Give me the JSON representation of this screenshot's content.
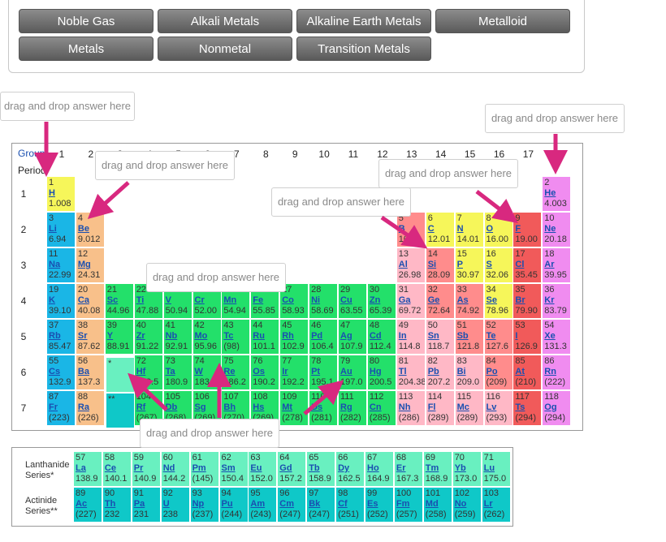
{
  "bank": {
    "buttons": [
      "Noble Gas",
      "Alkali Metals",
      "Alkaline Earth Metals",
      "Metalloid",
      "Metals",
      "Nonmetal",
      "Transition Metals"
    ]
  },
  "drop_placeholder": "drag and drop answer here",
  "headers": {
    "group": "Group",
    "period": "Period"
  },
  "groups": [
    "1",
    "2",
    "3",
    "4",
    "5",
    "6",
    "7",
    "8",
    "9",
    "10",
    "11",
    "12",
    "13",
    "14",
    "15",
    "16",
    "17",
    "18"
  ],
  "periods": [
    "1",
    "2",
    "3",
    "4",
    "5",
    "6",
    "7"
  ],
  "lanthanide_label": "Lanthanide Series*",
  "actinide_label": "Actinide Series**",
  "lanthanide_marker": "*",
  "actinide_marker": "**",
  "colors": {
    "alkali": "#1ab6e6",
    "alkaline": "#f8c08a",
    "transition": "#23e06a",
    "post_transition": "#ffb8c6",
    "metalloid": "#ff8c8c",
    "nonmetal": "#f6f65a",
    "halogen": "#f15a5a",
    "noble": "#f08cf0",
    "lanthanide": "#69f0c0",
    "actinide": "#0fc8c8",
    "hydrogen": "#f6f65a"
  },
  "elements": [
    {
      "n": "1",
      "s": "H",
      "w": "1.008",
      "c": "hydrogen",
      "g": 1,
      "p": 1
    },
    {
      "n": "2",
      "s": "He",
      "w": "4.003",
      "c": "noble",
      "g": 18,
      "p": 1
    },
    {
      "n": "3",
      "s": "Li",
      "w": "6.94",
      "c": "alkali",
      "g": 1,
      "p": 2
    },
    {
      "n": "4",
      "s": "Be",
      "w": "9.012",
      "c": "alkaline",
      "g": 2,
      "p": 2
    },
    {
      "n": "5",
      "s": "B",
      "w": "10.81",
      "c": "metalloid",
      "g": 13,
      "p": 2
    },
    {
      "n": "6",
      "s": "C",
      "w": "12.01",
      "c": "nonmetal",
      "g": 14,
      "p": 2
    },
    {
      "n": "7",
      "s": "N",
      "w": "14.01",
      "c": "nonmetal",
      "g": 15,
      "p": 2
    },
    {
      "n": "8",
      "s": "O",
      "w": "16.00",
      "c": "nonmetal",
      "g": 16,
      "p": 2
    },
    {
      "n": "9",
      "s": "F",
      "w": "19.00",
      "c": "halogen",
      "g": 17,
      "p": 2
    },
    {
      "n": "10",
      "s": "Ne",
      "w": "20.18",
      "c": "noble",
      "g": 18,
      "p": 2
    },
    {
      "n": "11",
      "s": "Na",
      "w": "22.99",
      "c": "alkali",
      "g": 1,
      "p": 3
    },
    {
      "n": "12",
      "s": "Mg",
      "w": "24.31",
      "c": "alkaline",
      "g": 2,
      "p": 3
    },
    {
      "n": "13",
      "s": "Al",
      "w": "26.98",
      "c": "post_transition",
      "g": 13,
      "p": 3
    },
    {
      "n": "14",
      "s": "Si",
      "w": "28.09",
      "c": "metalloid",
      "g": 14,
      "p": 3
    },
    {
      "n": "15",
      "s": "P",
      "w": "30.97",
      "c": "nonmetal",
      "g": 15,
      "p": 3
    },
    {
      "n": "16",
      "s": "S",
      "w": "32.06",
      "c": "nonmetal",
      "g": 16,
      "p": 3
    },
    {
      "n": "17",
      "s": "Cl",
      "w": "35.45",
      "c": "halogen",
      "g": 17,
      "p": 3
    },
    {
      "n": "18",
      "s": "Ar",
      "w": "39.95",
      "c": "noble",
      "g": 18,
      "p": 3
    },
    {
      "n": "19",
      "s": "K",
      "w": "39.10",
      "c": "alkali",
      "g": 1,
      "p": 4
    },
    {
      "n": "20",
      "s": "Ca",
      "w": "40.08",
      "c": "alkaline",
      "g": 2,
      "p": 4
    },
    {
      "n": "21",
      "s": "Sc",
      "w": "44.96",
      "c": "transition",
      "g": 3,
      "p": 4
    },
    {
      "n": "22",
      "s": "Ti",
      "w": "47.88",
      "c": "transition",
      "g": 4,
      "p": 4
    },
    {
      "n": "23",
      "s": "V",
      "w": "50.94",
      "c": "transition",
      "g": 5,
      "p": 4
    },
    {
      "n": "24",
      "s": "Cr",
      "w": "52.00",
      "c": "transition",
      "g": 6,
      "p": 4
    },
    {
      "n": "25",
      "s": "Mn",
      "w": "54.94",
      "c": "transition",
      "g": 7,
      "p": 4
    },
    {
      "n": "26",
      "s": "Fe",
      "w": "55.85",
      "c": "transition",
      "g": 8,
      "p": 4
    },
    {
      "n": "27",
      "s": "Co",
      "w": "58.93",
      "c": "transition",
      "g": 9,
      "p": 4
    },
    {
      "n": "28",
      "s": "Ni",
      "w": "58.69",
      "c": "transition",
      "g": 10,
      "p": 4
    },
    {
      "n": "29",
      "s": "Cu",
      "w": "63.55",
      "c": "transition",
      "g": 11,
      "p": 4
    },
    {
      "n": "30",
      "s": "Zn",
      "w": "65.39",
      "c": "transition",
      "g": 12,
      "p": 4
    },
    {
      "n": "31",
      "s": "Ga",
      "w": "69.72",
      "c": "post_transition",
      "g": 13,
      "p": 4
    },
    {
      "n": "32",
      "s": "Ge",
      "w": "72.64",
      "c": "metalloid",
      "g": 14,
      "p": 4
    },
    {
      "n": "33",
      "s": "As",
      "w": "74.92",
      "c": "metalloid",
      "g": 15,
      "p": 4
    },
    {
      "n": "34",
      "s": "Se",
      "w": "78.96",
      "c": "nonmetal",
      "g": 16,
      "p": 4
    },
    {
      "n": "35",
      "s": "Br",
      "w": "79.90",
      "c": "halogen",
      "g": 17,
      "p": 4
    },
    {
      "n": "36",
      "s": "Kr",
      "w": "83.79",
      "c": "noble",
      "g": 18,
      "p": 4
    },
    {
      "n": "37",
      "s": "Rb",
      "w": "85.47",
      "c": "alkali",
      "g": 1,
      "p": 5
    },
    {
      "n": "38",
      "s": "Sr",
      "w": "87.62",
      "c": "alkaline",
      "g": 2,
      "p": 5
    },
    {
      "n": "39",
      "s": "Y",
      "w": "88.91",
      "c": "transition",
      "g": 3,
      "p": 5
    },
    {
      "n": "40",
      "s": "Zr",
      "w": "91.22",
      "c": "transition",
      "g": 4,
      "p": 5
    },
    {
      "n": "41",
      "s": "Nb",
      "w": "92.91",
      "c": "transition",
      "g": 5,
      "p": 5
    },
    {
      "n": "42",
      "s": "Mo",
      "w": "95.96",
      "c": "transition",
      "g": 6,
      "p": 5
    },
    {
      "n": "43",
      "s": "Tc",
      "w": "(98)",
      "c": "transition",
      "g": 7,
      "p": 5
    },
    {
      "n": "44",
      "s": "Ru",
      "w": "101.1",
      "c": "transition",
      "g": 8,
      "p": 5
    },
    {
      "n": "45",
      "s": "Rh",
      "w": "102.9",
      "c": "transition",
      "g": 9,
      "p": 5
    },
    {
      "n": "46",
      "s": "Pd",
      "w": "106.4",
      "c": "transition",
      "g": 10,
      "p": 5
    },
    {
      "n": "47",
      "s": "Ag",
      "w": "107.9",
      "c": "transition",
      "g": 11,
      "p": 5
    },
    {
      "n": "48",
      "s": "Cd",
      "w": "112.4",
      "c": "transition",
      "g": 12,
      "p": 5
    },
    {
      "n": "49",
      "s": "In",
      "w": "114.8",
      "c": "post_transition",
      "g": 13,
      "p": 5
    },
    {
      "n": "50",
      "s": "Sn",
      "w": "118.7",
      "c": "post_transition",
      "g": 14,
      "p": 5
    },
    {
      "n": "51",
      "s": "Sb",
      "w": "121.8",
      "c": "metalloid",
      "g": 15,
      "p": 5
    },
    {
      "n": "52",
      "s": "Te",
      "w": "127.6",
      "c": "metalloid",
      "g": 16,
      "p": 5
    },
    {
      "n": "53",
      "s": "I",
      "w": "126.9",
      "c": "halogen",
      "g": 17,
      "p": 5
    },
    {
      "n": "54",
      "s": "Xe",
      "w": "131.3",
      "c": "noble",
      "g": 18,
      "p": 5
    },
    {
      "n": "55",
      "s": "Cs",
      "w": "132.9",
      "c": "alkali",
      "g": 1,
      "p": 6
    },
    {
      "n": "56",
      "s": "Ba",
      "w": "137.3",
      "c": "alkaline",
      "g": 2,
      "p": 6
    },
    {
      "n": "72",
      "s": "Hf",
      "w": "178.5",
      "c": "transition",
      "g": 4,
      "p": 6
    },
    {
      "n": "73",
      "s": "Ta",
      "w": "180.9",
      "c": "transition",
      "g": 5,
      "p": 6
    },
    {
      "n": "74",
      "s": "W",
      "w": "183.8",
      "c": "transition",
      "g": 6,
      "p": 6
    },
    {
      "n": "75",
      "s": "Re",
      "w": "186.2",
      "c": "transition",
      "g": 7,
      "p": 6
    },
    {
      "n": "76",
      "s": "Os",
      "w": "190.2",
      "c": "transition",
      "g": 8,
      "p": 6
    },
    {
      "n": "77",
      "s": "Ir",
      "w": "192.2",
      "c": "transition",
      "g": 9,
      "p": 6
    },
    {
      "n": "78",
      "s": "Pt",
      "w": "195.1",
      "c": "transition",
      "g": 10,
      "p": 6
    },
    {
      "n": "79",
      "s": "Au",
      "w": "197.0",
      "c": "transition",
      "g": 11,
      "p": 6
    },
    {
      "n": "80",
      "s": "Hg",
      "w": "200.5",
      "c": "transition",
      "g": 12,
      "p": 6
    },
    {
      "n": "81",
      "s": "Tl",
      "w": "204.38",
      "c": "post_transition",
      "g": 13,
      "p": 6
    },
    {
      "n": "82",
      "s": "Pb",
      "w": "207.2",
      "c": "post_transition",
      "g": 14,
      "p": 6
    },
    {
      "n": "83",
      "s": "Bi",
      "w": "209.0",
      "c": "post_transition",
      "g": 15,
      "p": 6
    },
    {
      "n": "84",
      "s": "Po",
      "w": "(209)",
      "c": "metalloid",
      "g": 16,
      "p": 6
    },
    {
      "n": "85",
      "s": "At",
      "w": "(210)",
      "c": "halogen",
      "g": 17,
      "p": 6
    },
    {
      "n": "86",
      "s": "Rn",
      "w": "(222)",
      "c": "noble",
      "g": 18,
      "p": 6
    },
    {
      "n": "87",
      "s": "Fr",
      "w": "(223)",
      "c": "alkali",
      "g": 1,
      "p": 7
    },
    {
      "n": "88",
      "s": "Ra",
      "w": "(226)",
      "c": "alkaline",
      "g": 2,
      "p": 7
    },
    {
      "n": "104",
      "s": "Rf",
      "w": "(267)",
      "c": "transition",
      "g": 4,
      "p": 7
    },
    {
      "n": "105",
      "s": "Db",
      "w": "(268)",
      "c": "transition",
      "g": 5,
      "p": 7
    },
    {
      "n": "106",
      "s": "Sg",
      "w": "(269)",
      "c": "transition",
      "g": 6,
      "p": 7
    },
    {
      "n": "107",
      "s": "Bh",
      "w": "(270)",
      "c": "transition",
      "g": 7,
      "p": 7
    },
    {
      "n": "108",
      "s": "Hs",
      "w": "(269)",
      "c": "transition",
      "g": 8,
      "p": 7
    },
    {
      "n": "109",
      "s": "Mt",
      "w": "(278)",
      "c": "transition",
      "g": 9,
      "p": 7
    },
    {
      "n": "110",
      "s": "Ds",
      "w": "(281)",
      "c": "transition",
      "g": 10,
      "p": 7
    },
    {
      "n": "111",
      "s": "Rg",
      "w": "(282)",
      "c": "transition",
      "g": 11,
      "p": 7
    },
    {
      "n": "112",
      "s": "Cn",
      "w": "(285)",
      "c": "transition",
      "g": 12,
      "p": 7
    },
    {
      "n": "113",
      "s": "Nh",
      "w": "(286)",
      "c": "post_transition",
      "g": 13,
      "p": 7
    },
    {
      "n": "114",
      "s": "Fl",
      "w": "(289)",
      "c": "post_transition",
      "g": 14,
      "p": 7
    },
    {
      "n": "115",
      "s": "Mc",
      "w": "(289)",
      "c": "post_transition",
      "g": 15,
      "p": 7
    },
    {
      "n": "116",
      "s": "Lv",
      "w": "(293)",
      "c": "post_transition",
      "g": 16,
      "p": 7
    },
    {
      "n": "117",
      "s": "Ts",
      "w": "(294)",
      "c": "halogen",
      "g": 17,
      "p": 7
    },
    {
      "n": "118",
      "s": "Og",
      "w": "(294)",
      "c": "noble",
      "g": 18,
      "p": 7
    }
  ],
  "lanthanides": [
    {
      "n": "57",
      "s": "La",
      "w": "138.9"
    },
    {
      "n": "58",
      "s": "Ce",
      "w": "140.1"
    },
    {
      "n": "59",
      "s": "Pr",
      "w": "140.9"
    },
    {
      "n": "60",
      "s": "Nd",
      "w": "144.2"
    },
    {
      "n": "61",
      "s": "Pm",
      "w": "(145)"
    },
    {
      "n": "62",
      "s": "Sm",
      "w": "150.4"
    },
    {
      "n": "63",
      "s": "Eu",
      "w": "152.0"
    },
    {
      "n": "64",
      "s": "Gd",
      "w": "157.2"
    },
    {
      "n": "65",
      "s": "Tb",
      "w": "158.9"
    },
    {
      "n": "66",
      "s": "Dy",
      "w": "162.5"
    },
    {
      "n": "67",
      "s": "Ho",
      "w": "164.9"
    },
    {
      "n": "68",
      "s": "Er",
      "w": "167.3"
    },
    {
      "n": "69",
      "s": "Tm",
      "w": "168.9"
    },
    {
      "n": "70",
      "s": "Yb",
      "w": "173.0"
    },
    {
      "n": "71",
      "s": "Lu",
      "w": "175.0"
    }
  ],
  "actinides": [
    {
      "n": "89",
      "s": "Ac",
      "w": "(227)"
    },
    {
      "n": "90",
      "s": "Th",
      "w": "232"
    },
    {
      "n": "91",
      "s": "Pa",
      "w": "231"
    },
    {
      "n": "92",
      "s": "U",
      "w": "238"
    },
    {
      "n": "93",
      "s": "Np",
      "w": "(237)"
    },
    {
      "n": "94",
      "s": "Pu",
      "w": "(244)"
    },
    {
      "n": "95",
      "s": "Am",
      "w": "(243)"
    },
    {
      "n": "96",
      "s": "Cm",
      "w": "(247)"
    },
    {
      "n": "97",
      "s": "Bk",
      "w": "(247)"
    },
    {
      "n": "98",
      "s": "Cf",
      "w": "(251)"
    },
    {
      "n": "99",
      "s": "Es",
      "w": "(252)"
    },
    {
      "n": "100",
      "s": "Fm",
      "w": "(257)"
    },
    {
      "n": "101",
      "s": "Md",
      "w": "(258)"
    },
    {
      "n": "102",
      "s": "No",
      "w": "(259)"
    },
    {
      "n": "103",
      "s": "Lr",
      "w": "(262)"
    }
  ]
}
